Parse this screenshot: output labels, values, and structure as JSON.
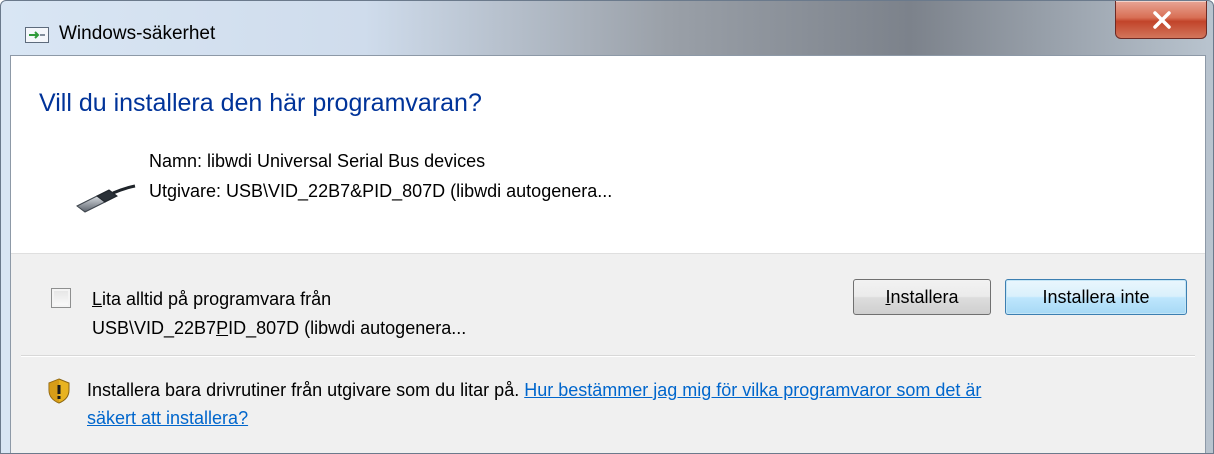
{
  "window": {
    "title": "Windows-säkerhet",
    "close_label": "X"
  },
  "main": {
    "question": "Vill du installera den här programvaran?",
    "name_line": "Namn: libwdi Universal Serial Bus devices",
    "publisher_line": "Utgivare: USB\\VID_22B7&PID_807D (libwdi autogenera..."
  },
  "options": {
    "trust_checkbox_checked": false,
    "trust_label_accel": "L",
    "trust_label_rest": "ita alltid på programvara från",
    "trust_publisher_pre": "USB\\VID_22B7",
    "trust_publisher_accel": "P",
    "trust_publisher_post": "ID_807D (libwdi autogenera...",
    "install_accel": "I",
    "install_rest": "nstallera",
    "dont_install_label": "Installera inte"
  },
  "footer": {
    "warning_text": "Installera bara drivrutiner från utgivare som du litar på.",
    "link_part1": "Hur bestämmer jag mig för vilka programvaror som det är",
    "link_part2": "säkert att installera?"
  }
}
